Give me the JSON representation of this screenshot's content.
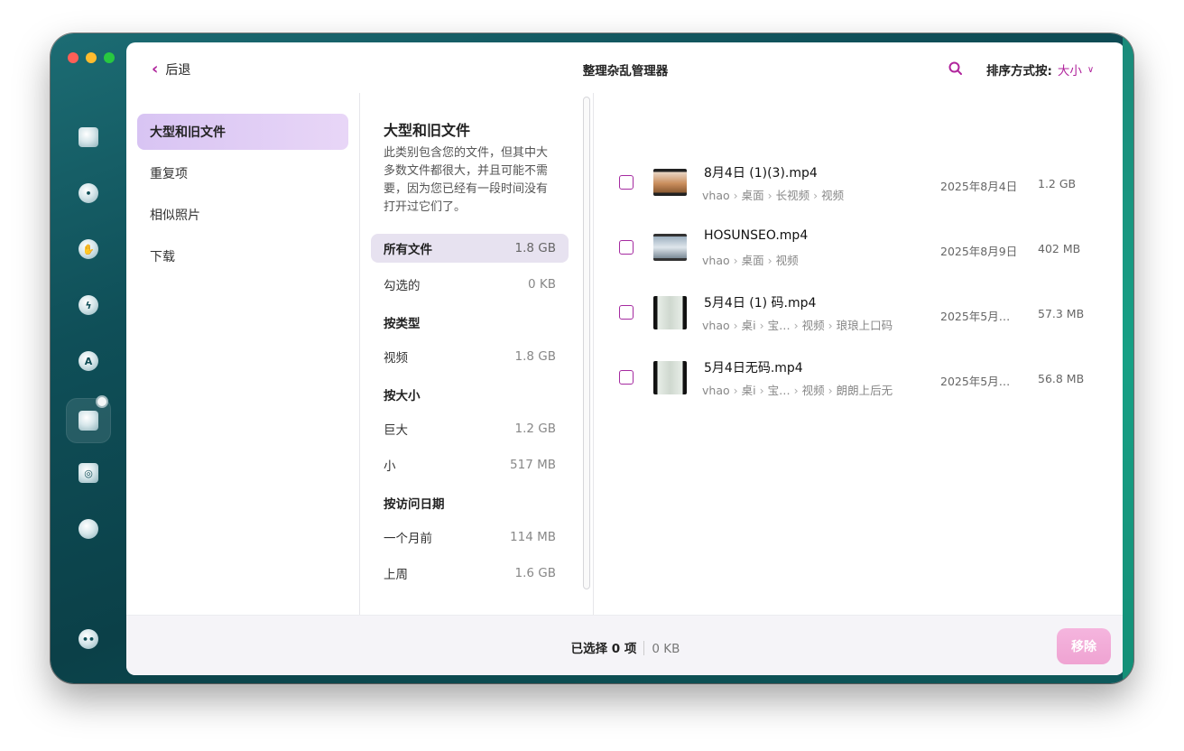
{
  "window": {
    "title": "整理杂乱管理器"
  },
  "colors": {
    "accent": "#b0249c",
    "active_category": "#dcc8f4",
    "remove_button": "#f2acd8"
  },
  "header": {
    "back_label": "后退",
    "search_icon": "search-icon",
    "sort_label": "排序方式按:",
    "sort_value": "大小"
  },
  "sidebar": {
    "items": [
      {
        "icon": "system-junk-icon"
      },
      {
        "icon": "protection-icon"
      },
      {
        "icon": "privacy-hand-icon"
      },
      {
        "icon": "speed-bolt-icon"
      },
      {
        "icon": "applications-icon"
      },
      {
        "icon": "clutter-folder-icon"
      },
      {
        "icon": "space-lens-icon"
      },
      {
        "icon": "cloud-icon"
      },
      {
        "icon": "assistant-icon"
      }
    ]
  },
  "categories": [
    {
      "label": "大型和旧文件",
      "active": true
    },
    {
      "label": "重复项"
    },
    {
      "label": "相似照片"
    },
    {
      "label": "下载"
    }
  ],
  "section": {
    "title": "大型和旧文件",
    "description": "此类别包含您的文件，但其中大多数文件都很大，并且可能不需要，因为您已经有一段时间没有打开过它们了。"
  },
  "filters": {
    "all": {
      "label": "所有文件",
      "size": "1.8 GB"
    },
    "checked": {
      "label": "勾选的",
      "size": "0 KB"
    },
    "by_type_heading": "按类型",
    "video": {
      "label": "视频",
      "size": "1.8 GB"
    },
    "by_size_heading": "按大小",
    "huge": {
      "label": "巨大",
      "size": "1.2 GB"
    },
    "small": {
      "label": "小",
      "size": "517 MB"
    },
    "by_access_heading": "按访问日期",
    "month_ago": {
      "label": "一个月前",
      "size": "114 MB"
    },
    "last_week": {
      "label": "上周",
      "size": "1.6 GB"
    }
  },
  "files": [
    {
      "name": "8月4日 (1)(3).mp4",
      "path": [
        "vhao",
        "桌面",
        "长视频",
        "视频"
      ],
      "date": "2025年8月4日",
      "size": "1.2 GB"
    },
    {
      "name": "HOSUNSEO.mp4",
      "path": [
        "vhao",
        "桌面",
        "视频"
      ],
      "date": "2025年8月9日",
      "size": "402 MB"
    },
    {
      "name": "5月4日 (1) 码.mp4",
      "path": [
        "vhao",
        "桌i",
        "宝…",
        "视频",
        "琅琅上口码"
      ],
      "date": "2025年5月…",
      "size": "57.3 MB"
    },
    {
      "name": "5月4日无码.mp4",
      "path": [
        "vhao",
        "桌i",
        "宝…",
        "视频",
        "朗朗上后无"
      ],
      "date": "2025年5月…",
      "size": "56.8 MB"
    }
  ],
  "footer": {
    "selected": "已选择 0 项",
    "selected_size": "0 KB",
    "remove_label": "移除"
  }
}
